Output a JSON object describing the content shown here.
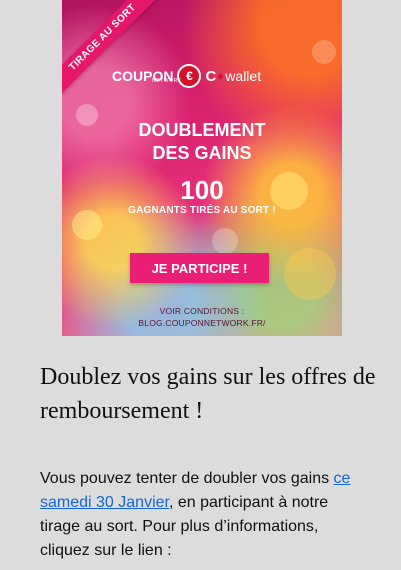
{
  "promo": {
    "ribbon": "TIRAGE AU SORT",
    "logo": {
      "coupon": "COUPON",
      "network": "NETWORK",
      "euro": "€",
      "c": "C",
      "wallet": "wallet"
    },
    "headline_1": "DOUBLEMENT",
    "headline_2": "DES GAINS",
    "count": "100",
    "winners": "GAGNANTS TIRÉS AU SORT !",
    "cta": "JE PARTICIPE !",
    "conditions_1": "VOIR CONDITIONS :",
    "conditions_2": "BLOG.COUPONNETWORK.FR/"
  },
  "article": {
    "title": "Doublez vos gains sur les offres de remboursement !",
    "body_start": "Vous pouvez tenter de doubler vos gains ",
    "body_link": "ce samedi 30 Janvier",
    "body_end": ", en participant à notre tirage au sort. Pour plus d’informations, cliquez sur le lien :"
  },
  "colors": {
    "background": "#dcdcdc",
    "link": "#1565d8",
    "cta": "#e91e74"
  }
}
